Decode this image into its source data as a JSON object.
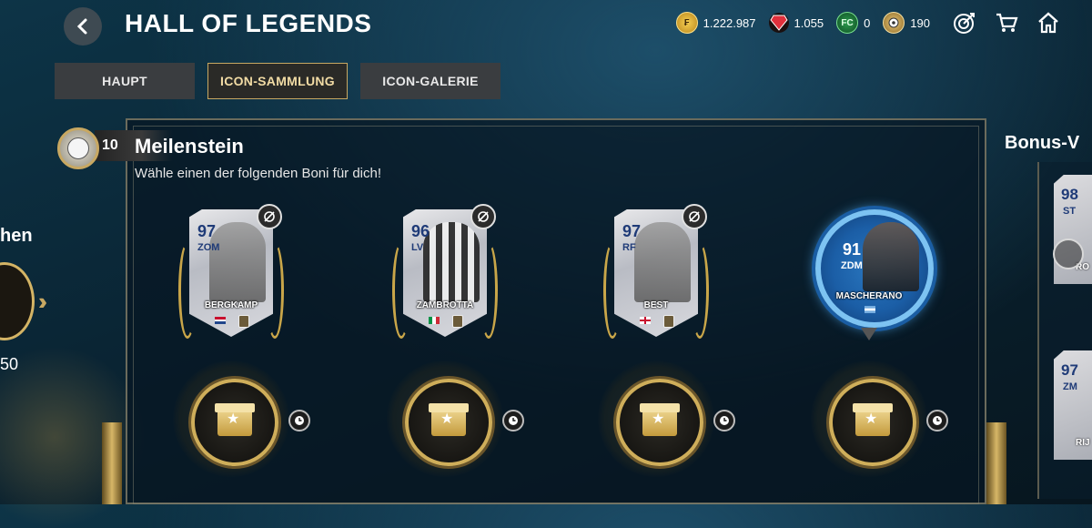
{
  "header": {
    "title": "HALL OF LEGENDS",
    "currencies": [
      {
        "icon": "fc-points-icon",
        "value": "1.222.987"
      },
      {
        "icon": "gem-icon",
        "value": "1.055"
      },
      {
        "icon": "fc-mobile-token-icon",
        "value": "0"
      },
      {
        "icon": "ball-token-icon",
        "value": "190"
      }
    ]
  },
  "tabs": [
    {
      "label": "HAUPT",
      "active": false
    },
    {
      "label": "ICON-SAMMLUNG",
      "active": true
    },
    {
      "label": "ICON-GALERIE",
      "active": false
    }
  ],
  "left_panel": {
    "label": "hen",
    "value": "50"
  },
  "milestone": {
    "count": "10",
    "title": "Meilenstein",
    "subtitle": "Wähle einen der folgenden Boni für dich!"
  },
  "rewards": [
    {
      "rating": "97",
      "position": "ZOM",
      "name": "BERGKAMP",
      "nation": "netherlands",
      "card_style": "icon"
    },
    {
      "rating": "96",
      "position": "LV",
      "name": "ZAMBROTTA",
      "nation": "italy",
      "card_style": "icon"
    },
    {
      "rating": "97",
      "position": "RF",
      "name": "BEST",
      "nation": "northern-ireland",
      "card_style": "icon"
    },
    {
      "rating": "91",
      "position": "ZDM",
      "name": "MASCHERANO",
      "nation": "argentina",
      "card_style": "round-blue"
    }
  ],
  "right_panel": {
    "title": "Bonus-V",
    "cards": [
      {
        "rating": "98",
        "position": "ST",
        "name": "RO"
      },
      {
        "rating": "97",
        "position": "ZM",
        "name": "RIJ"
      }
    ]
  },
  "colors": {
    "accent_gold": "#c8a862",
    "background": "#0a2433",
    "tab_bg": "#3a3d40",
    "blue_card": "#1b5ea6"
  }
}
